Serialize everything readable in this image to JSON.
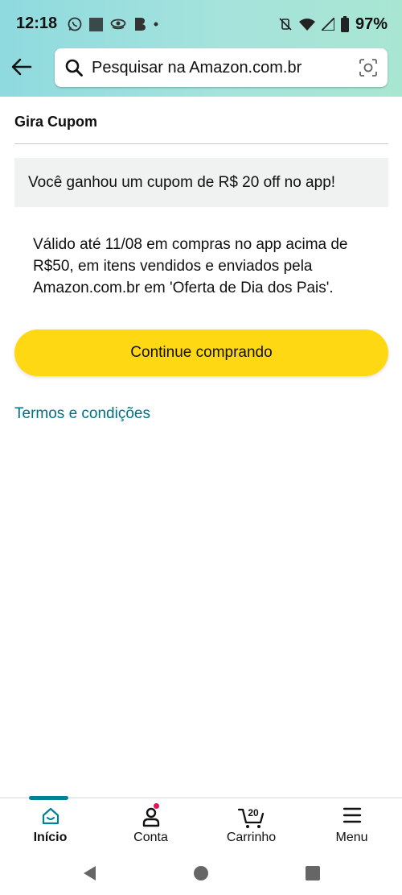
{
  "status_bar": {
    "time": "12:18",
    "battery": "97%"
  },
  "search": {
    "placeholder": "Pesquisar na Amazon.com.br"
  },
  "page": {
    "title": "Gira Cupom",
    "coupon_banner": "Você ganhou um cupom de R$ 20 off no app!",
    "description": "Válido até 11/08 em compras no app acima de R$50, em itens vendidos e enviados pela Amazon.com.br em 'Oferta de Dia dos Pais'.",
    "cta_label": "Continue comprando",
    "terms_link": "Termos e condições"
  },
  "bottom_nav": {
    "items": [
      {
        "label": "Início",
        "icon": "home-icon",
        "active": true
      },
      {
        "label": "Conta",
        "icon": "account-icon",
        "active": false
      },
      {
        "label": "Carrinho",
        "icon": "cart-icon",
        "active": false,
        "badge": "20"
      },
      {
        "label": "Menu",
        "icon": "menu-icon",
        "active": false
      }
    ]
  },
  "colors": {
    "header_gradient_start": "#8fdadf",
    "header_gradient_end": "#a9e6d2",
    "cta_yellow": "#ffd814",
    "link_teal": "#007185",
    "active_nav": "#008296",
    "notification_dot": "#e0115f"
  }
}
